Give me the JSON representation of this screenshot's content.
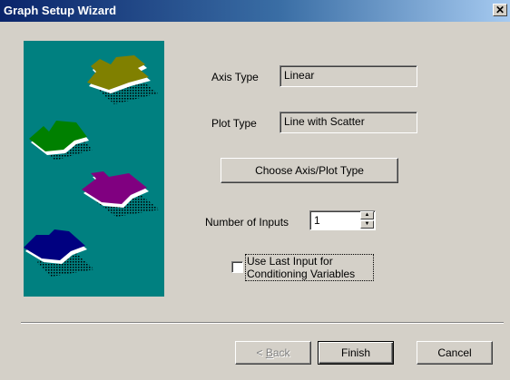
{
  "window": {
    "title": "Graph Setup Wizard",
    "close_glyph": "✕"
  },
  "form": {
    "axis_type_label": "Axis Type",
    "axis_type_value": "Linear",
    "plot_type_label": "Plot Type",
    "plot_type_value": "Line with Scatter",
    "choose_button": "Choose Axis/Plot Type",
    "num_inputs_label": "Number of Inputs",
    "num_inputs_value": "1",
    "checkbox_label_line1": "Use Last Input for",
    "checkbox_label_line2": "Conditioning Variables",
    "checkbox_checked": false
  },
  "footer": {
    "back_label_prefix": "< ",
    "back_label_mnemonic": "B",
    "back_label_rest": "ack",
    "finish_label": "Finish",
    "cancel_label": "Cancel"
  },
  "art": {
    "background": "#008080",
    "pieces": [
      {
        "color": "#808000"
      },
      {
        "color": "#008000"
      },
      {
        "color": "#800080"
      },
      {
        "color": "#000080"
      }
    ]
  }
}
